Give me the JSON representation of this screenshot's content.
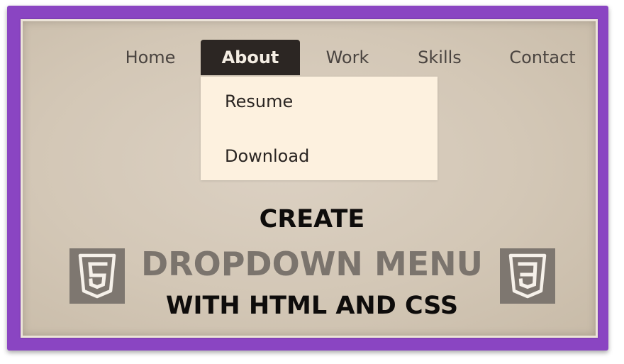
{
  "nav": {
    "items": [
      {
        "label": "Home"
      },
      {
        "label": "About"
      },
      {
        "label": "Work"
      },
      {
        "label": "Skills"
      },
      {
        "label": "Contact"
      }
    ],
    "active": "About"
  },
  "dropdown": {
    "items": [
      {
        "label": "Resume"
      },
      {
        "label": "Download"
      }
    ]
  },
  "headline": {
    "line1": "CREATE",
    "line2": "DROPDOWN MENU",
    "line3": "WITH HTML AND CSS"
  },
  "logos": {
    "left": {
      "icon": "html5-icon",
      "glyph": "5"
    },
    "right": {
      "icon": "css3-icon",
      "glyph": "3"
    }
  },
  "colors": {
    "frame": "#8a45c2",
    "panel": "#d3c7b6",
    "active_tab": "#2c2623",
    "dropdown_bg": "#fdf1df",
    "logo_bg": "#7e7770",
    "headline_grey": "#7b746d"
  }
}
